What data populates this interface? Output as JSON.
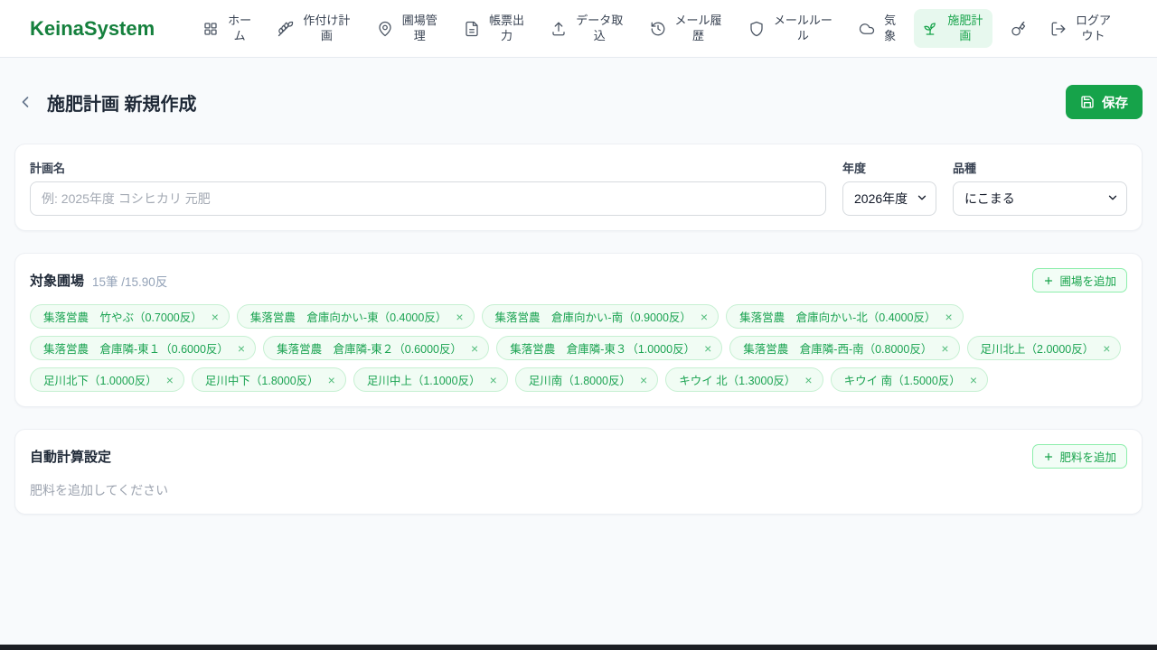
{
  "nav": {
    "brand": "KeinaSystem",
    "items": [
      {
        "label": "ホーム",
        "icon": "home-grid-icon",
        "active": false
      },
      {
        "label": "作付け計画",
        "icon": "wheat-icon",
        "active": false
      },
      {
        "label": "圃場管理",
        "icon": "map-pin-icon",
        "active": false
      },
      {
        "label": "帳票出力",
        "icon": "document-icon",
        "active": false
      },
      {
        "label": "データ取込",
        "icon": "upload-icon",
        "active": false
      },
      {
        "label": "メール履歴",
        "icon": "history-icon",
        "active": false
      },
      {
        "label": "メールルール",
        "icon": "shield-icon",
        "active": false
      },
      {
        "label": "気象",
        "icon": "cloud-icon",
        "active": false
      },
      {
        "label": "施肥計画",
        "icon": "sprout-icon",
        "active": true
      },
      {
        "label": "",
        "icon": "key-icon",
        "active": false
      },
      {
        "label": "ログアウト",
        "icon": "logout-icon",
        "active": false
      }
    ]
  },
  "header": {
    "title": "施肥計画 新規作成",
    "save_label": "保存"
  },
  "plan_form": {
    "name_label": "計画名",
    "name_placeholder": "例: 2025年度 コシヒカリ 元肥",
    "name_value": "",
    "year_label": "年度",
    "year_value": "2026年度",
    "variety_label": "品種",
    "variety_value": "にこまる"
  },
  "fields_section": {
    "title": "対象圃場",
    "count_text": "15筆 /15.90反",
    "add_button_label": "圃場を追加",
    "remove_symbol": "×",
    "tags": [
      "集落営農　竹やぶ（0.7000反）",
      "集落営農　倉庫向かい-東（0.4000反）",
      "集落営農　倉庫向かい-南（0.9000反）",
      "集落営農　倉庫向かい-北（0.4000反）",
      "集落営農　倉庫隣-東１（0.6000反）",
      "集落営農　倉庫隣-東２（0.6000反）",
      "集落営農　倉庫隣-東３（1.0000反）",
      "集落営農　倉庫隣-西-南（0.8000反）",
      "足川北上（2.0000反）",
      "足川北下（1.0000反）",
      "足川中下（1.8000反）",
      "足川中上（1.1000反）",
      "足川南（1.8000反）",
      "キウイ 北（1.3000反）",
      "キウイ 南（1.5000反）"
    ]
  },
  "fertilizer_section": {
    "title": "自動計算設定",
    "add_button_label": "肥料を追加",
    "empty_text": "肥料を追加してください"
  },
  "colors": {
    "brand_green": "#15803d",
    "primary_green": "#16a34a",
    "active_nav_bg": "#e7f8ee",
    "tag_bg": "#f1fcf4",
    "tag_border": "#c6f0d2",
    "page_bg": "#f8fafc",
    "bottom_bar": "#1c1e24"
  }
}
